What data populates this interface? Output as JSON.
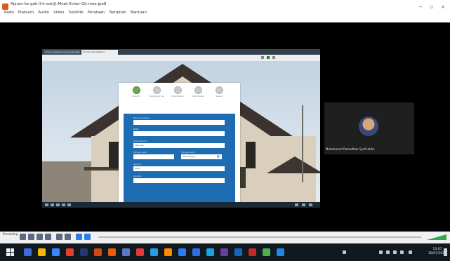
{
  "window": {
    "title": "Ajaran-ke-gak-ll-k-vok/jt-Meet-5cher-Gtj-mee.jpe8",
    "menu": [
      "Rodo",
      "Plataum",
      "Audio",
      "Video",
      "Subtitle",
      "Perataan",
      "Tampilan",
      "Bantuan"
    ],
    "minimize": "−",
    "maximize": "▫",
    "close": "×"
  },
  "browser": {
    "tabs": [
      "Video conferencing | Google Meet",
      "Formulir Pendaftaran"
    ]
  },
  "form": {
    "steps": [
      {
        "label": "Data Diri",
        "active": true
      },
      {
        "label": "Data Orang Tua",
        "active": false
      },
      {
        "label": "Data Sekolah",
        "active": false
      },
      {
        "label": "Data Prestasi",
        "active": false
      },
      {
        "label": "Selesai",
        "active": false
      }
    ],
    "fields": [
      {
        "label": "Nama Lengkap",
        "value": ""
      },
      {
        "label": "NISN",
        "value": ""
      },
      {
        "label": "Jenis Kelamin",
        "value": "Laki-laki"
      },
      {
        "label": "Tempat Lahir",
        "value": "",
        "label2": "Tanggal Lahir",
        "value2": "dd/mm/yyyy"
      },
      {
        "label": "Agama",
        "value": "Islam"
      },
      {
        "label": "Alamat",
        "value": ""
      }
    ]
  },
  "participant": {
    "name": "Muhammad Ramadhan Syafruddin"
  },
  "meeting_controls": {
    "label": "Presenting"
  },
  "tray": {
    "time": "13:07",
    "date": "30/07/2021"
  }
}
